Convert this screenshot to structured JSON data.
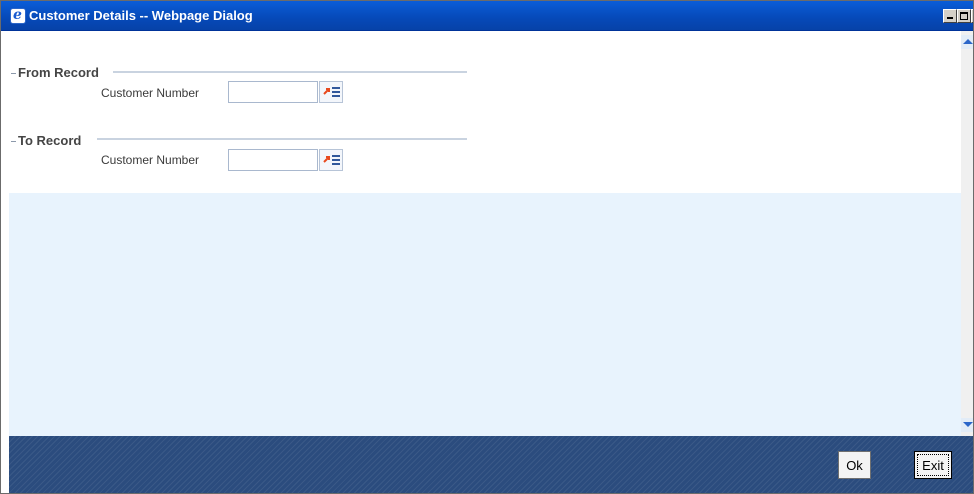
{
  "window": {
    "title": "Customer Details -- Webpage Dialog",
    "icon": "ie-icon",
    "controls": [
      "minimize",
      "maximize",
      "close"
    ]
  },
  "form": {
    "from_record": {
      "legend": "From Record",
      "field_label": "Customer Number",
      "value": "",
      "lov_icon": "list-of-values-icon"
    },
    "to_record": {
      "legend": "To Record",
      "field_label": "Customer Number",
      "value": "",
      "lov_icon": "list-of-values-icon"
    }
  },
  "footer": {
    "ok_label": "Ok",
    "exit_label": "Exit"
  },
  "colors": {
    "titlebar": "#0a5dd8",
    "content_bg": "#e8f3fd",
    "footer_bg": "#2b4c7e",
    "lov_arrow": "#e8491d"
  }
}
